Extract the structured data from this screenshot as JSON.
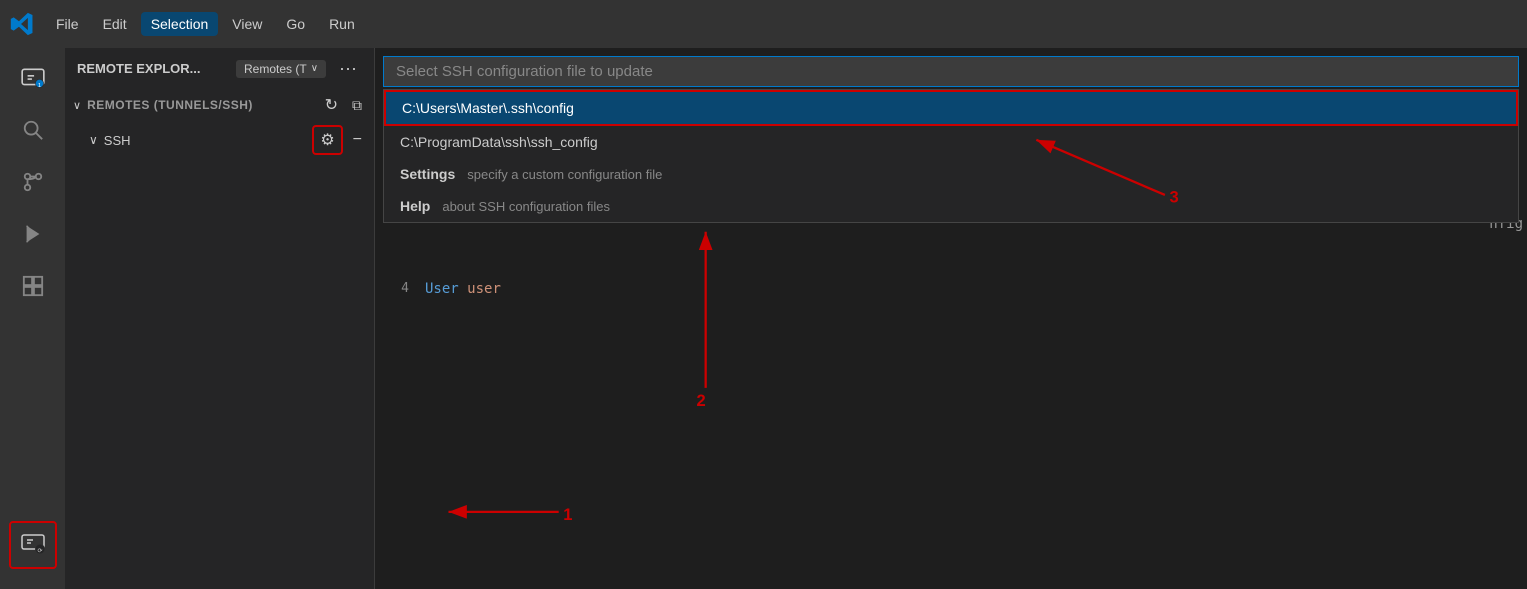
{
  "titlebar": {
    "menu_items": [
      "File",
      "Edit",
      "Selection",
      "View",
      "Go",
      "Run"
    ],
    "active_menu": "Selection"
  },
  "activity_bar": {
    "icons": [
      {
        "name": "remote-explorer",
        "symbol": "⬛",
        "label": "Remote Explorer",
        "badge": "1",
        "highlighted": true
      },
      {
        "name": "search",
        "symbol": "🔍",
        "label": "Search"
      },
      {
        "name": "source-control",
        "symbol": "⎇",
        "label": "Source Control"
      },
      {
        "name": "run-debug",
        "symbol": "▷",
        "label": "Run and Debug"
      },
      {
        "name": "extensions",
        "symbol": "⊞",
        "label": "Extensions"
      }
    ]
  },
  "sidebar": {
    "title": "REMOTE EXPLOR...",
    "dropdown_label": "Remotes (T",
    "section": {
      "label": "REMOTES (TUNNELS/SSH)",
      "subsection": "SSH"
    }
  },
  "dropdown": {
    "placeholder": "Select SSH configuration file to update",
    "items": [
      {
        "label": "C:\\Users\\Master\\.ssh\\config",
        "selected": true
      },
      {
        "label": "C:\\ProgramData\\ssh\\ssh_config",
        "selected": false
      },
      {
        "keyword": "Settings",
        "description": "specify a custom configuration file",
        "type": "settings"
      },
      {
        "keyword": "Help",
        "description": "about SSH configuration files",
        "type": "help"
      }
    ]
  },
  "editor": {
    "lines": [
      {
        "number": "4",
        "keyword": "User",
        "value": "user"
      }
    ]
  },
  "right_edge": {
    "text": "nfig"
  },
  "annotations": {
    "label_1": "1",
    "label_2": "2",
    "label_3": "3"
  }
}
